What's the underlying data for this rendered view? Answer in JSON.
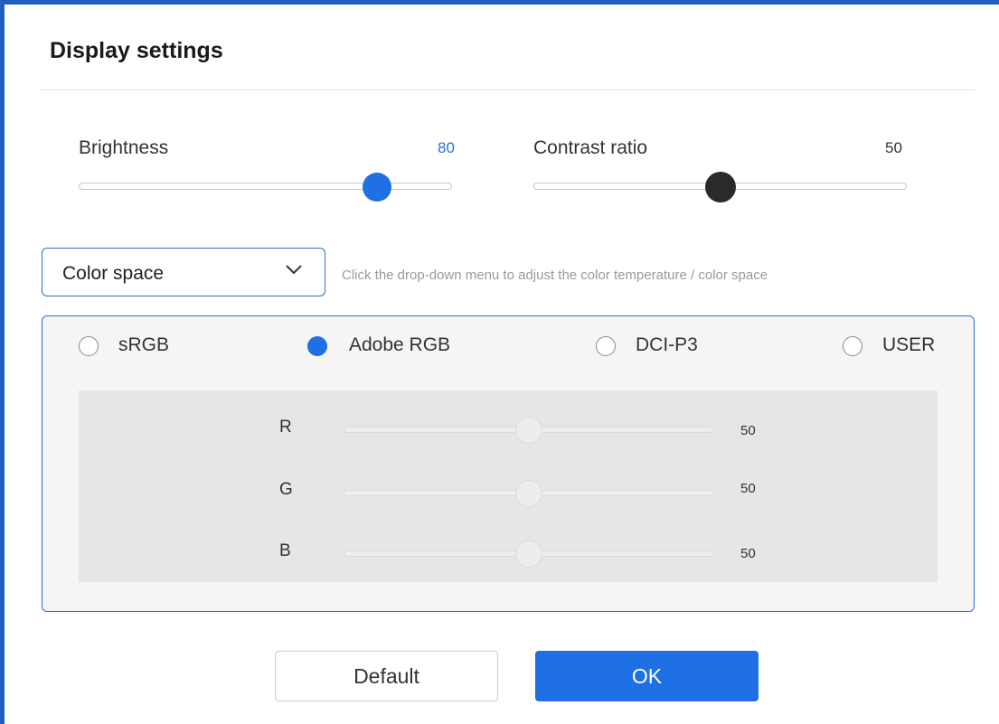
{
  "title": "Display settings",
  "brightness": {
    "label": "Brightness",
    "value": "80",
    "fraction": 0.8,
    "color": "#1f6fe5"
  },
  "contrast": {
    "label": "Contrast ratio",
    "value": "50",
    "fraction": 0.5,
    "color": "#2a2a2a"
  },
  "color_space": {
    "selected": "Color space",
    "hint": "Click the drop-down menu to adjust the color temperature / color space",
    "options": [
      {
        "label": "sRGB",
        "selected": false
      },
      {
        "label": "Adobe RGB",
        "selected": true
      },
      {
        "label": "DCI-P3",
        "selected": false
      },
      {
        "label": "USER",
        "selected": false
      }
    ]
  },
  "rgb": [
    {
      "label": "R",
      "value": "50",
      "fraction": 0.5
    },
    {
      "label": "G",
      "value": "50",
      "fraction": 0.5
    },
    {
      "label": "B",
      "value": "50",
      "fraction": 0.5
    }
  ],
  "buttons": {
    "default": "Default",
    "ok": "OK"
  },
  "colors": {
    "accent": "#1f6fe5",
    "frame": "#1f5fbf"
  }
}
